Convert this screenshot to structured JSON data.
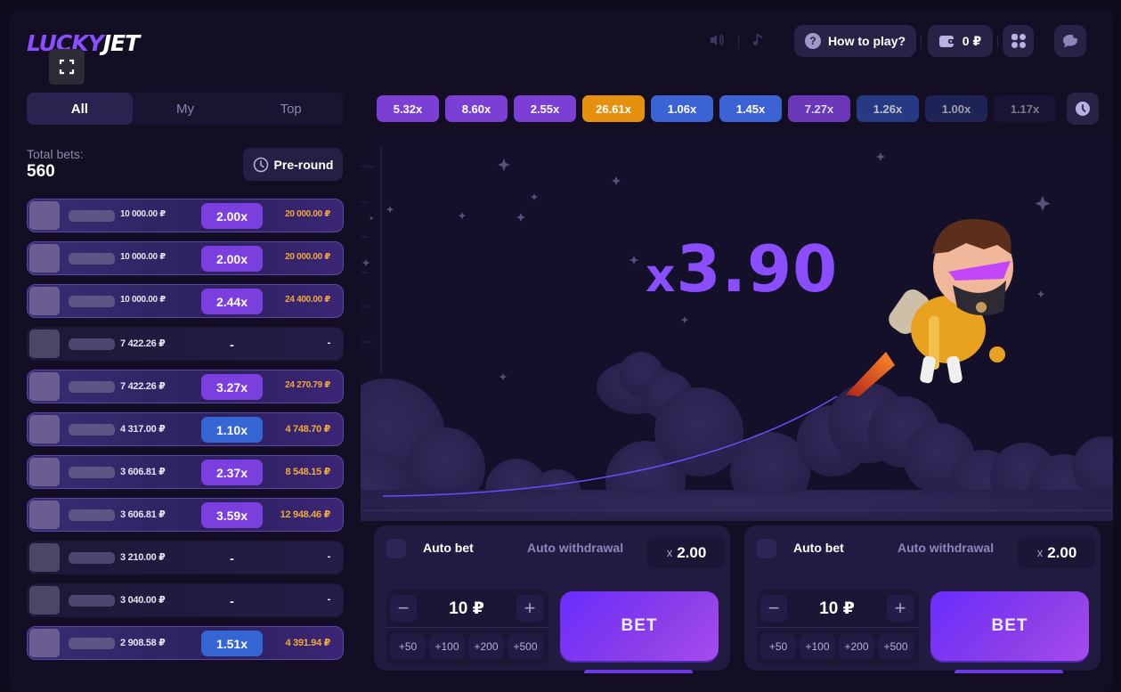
{
  "header": {
    "logo_part1": "LUCKY",
    "logo_part2": "JET",
    "sound_icon": "speaker-icon",
    "music_icon": "music-note-icon",
    "how_to_play": "How to play?",
    "balance": "0 ₽",
    "menu_icon": "grid-icon",
    "chat_icon": "chat-icon"
  },
  "tabs": [
    {
      "label": "All",
      "active": true
    },
    {
      "label": "My",
      "active": false
    },
    {
      "label": "Top",
      "active": false
    }
  ],
  "totals": {
    "label": "Total bets:",
    "value": "560",
    "preround_label": "Pre-round"
  },
  "bets": [
    {
      "amount": "10 000.00 ₽",
      "coef": "2.00x",
      "coef_color": "purple",
      "win": "20 000.00 ₽",
      "status": "win"
    },
    {
      "amount": "10 000.00 ₽",
      "coef": "2.00x",
      "coef_color": "purple",
      "win": "20 000.00 ₽",
      "status": "win"
    },
    {
      "amount": "10 000.00 ₽",
      "coef": "2.44x",
      "coef_color": "purple",
      "win": "24 400.00 ₽",
      "status": "win"
    },
    {
      "amount": "7 422.26 ₽",
      "coef": "-",
      "coef_color": "none",
      "win": "-",
      "status": "lose"
    },
    {
      "amount": "7 422.26 ₽",
      "coef": "3.27x",
      "coef_color": "purple",
      "win": "24 270.79 ₽",
      "status": "win"
    },
    {
      "amount": "4 317.00 ₽",
      "coef": "1.10x",
      "coef_color": "blue",
      "win": "4 748.70 ₽",
      "status": "win"
    },
    {
      "amount": "3 606.81 ₽",
      "coef": "2.37x",
      "coef_color": "purple",
      "win": "8 548.15 ₽",
      "status": "win"
    },
    {
      "amount": "3 606.81 ₽",
      "coef": "3.59x",
      "coef_color": "purple",
      "win": "12 948.46 ₽",
      "status": "win"
    },
    {
      "amount": "3 210.00 ₽",
      "coef": "-",
      "coef_color": "none",
      "win": "-",
      "status": "lose"
    },
    {
      "amount": "3 040.00 ₽",
      "coef": "-",
      "coef_color": "none",
      "win": "-",
      "status": "lose"
    },
    {
      "amount": "2 908.58 ₽",
      "coef": "1.51x",
      "coef_color": "blue",
      "win": "4 391.94 ₽",
      "status": "win"
    }
  ],
  "history": [
    {
      "value": "5.32x",
      "color": "#7b3fd6",
      "opacity": 1
    },
    {
      "value": "8.60x",
      "color": "#7b3fd6",
      "opacity": 1
    },
    {
      "value": "2.55x",
      "color": "#7b3fd6",
      "opacity": 1
    },
    {
      "value": "26.61x",
      "color": "#e5900f",
      "opacity": 1
    },
    {
      "value": "1.06x",
      "color": "#3b63d3",
      "opacity": 1
    },
    {
      "value": "1.45x",
      "color": "#3b63d3",
      "opacity": 1
    },
    {
      "value": "7.27x",
      "color": "#7b3fd6",
      "opacity": 0.85
    },
    {
      "value": "1.26x",
      "color": "#2e4aa6",
      "opacity": 0.75
    },
    {
      "value": "1.00x",
      "color": "#27337a",
      "opacity": 0.6
    },
    {
      "value": "1.17x",
      "color": "#201d4a",
      "opacity": 0.45
    }
  ],
  "game": {
    "multiplier_prefix": "x",
    "multiplier_value": "3.90",
    "character": "jetpack-pilot"
  },
  "panels": [
    {
      "auto_bet": "Auto bet",
      "auto_withdrawal": "Auto withdrawal",
      "withdraw_x": "x",
      "withdraw_value": "2.00",
      "stake": "10 ₽",
      "minus": "−",
      "plus": "+",
      "quick": [
        "+50",
        "+100",
        "+200",
        "+500"
      ],
      "bet_label": "BET"
    },
    {
      "auto_bet": "Auto bet",
      "auto_withdrawal": "Auto withdrawal",
      "withdraw_x": "x",
      "withdraw_value": "2.00",
      "stake": "10 ₽",
      "minus": "−",
      "plus": "+",
      "quick": [
        "+50",
        "+100",
        "+200",
        "+500"
      ],
      "bet_label": "BET"
    }
  ]
}
